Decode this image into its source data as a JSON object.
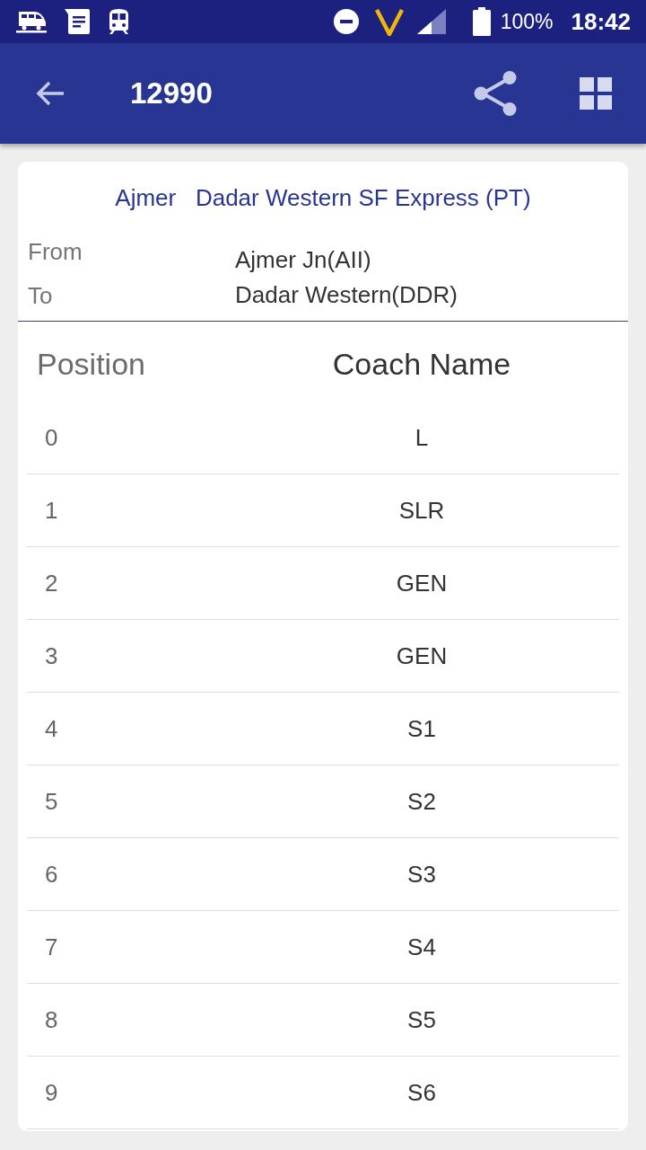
{
  "status_bar": {
    "battery": "100%",
    "time": "18:42"
  },
  "app_bar": {
    "title": "12990"
  },
  "train": {
    "name": "Ajmer   Dadar Western SF Express (PT)",
    "route": [
      {
        "label": "From",
        "value": "Ajmer Jn(AII)"
      },
      {
        "label": "To",
        "value": "Dadar Western(DDR)"
      }
    ]
  },
  "table": {
    "columns": [
      "Position",
      "Coach Name"
    ],
    "rows": [
      [
        "0",
        "L"
      ],
      [
        "1",
        "SLR"
      ],
      [
        "2",
        "GEN"
      ],
      [
        "3",
        "GEN"
      ],
      [
        "4",
        "S1"
      ],
      [
        "5",
        "S2"
      ],
      [
        "6",
        "S3"
      ],
      [
        "7",
        "S4"
      ],
      [
        "8",
        "S5"
      ],
      [
        "9",
        "S6"
      ]
    ]
  }
}
